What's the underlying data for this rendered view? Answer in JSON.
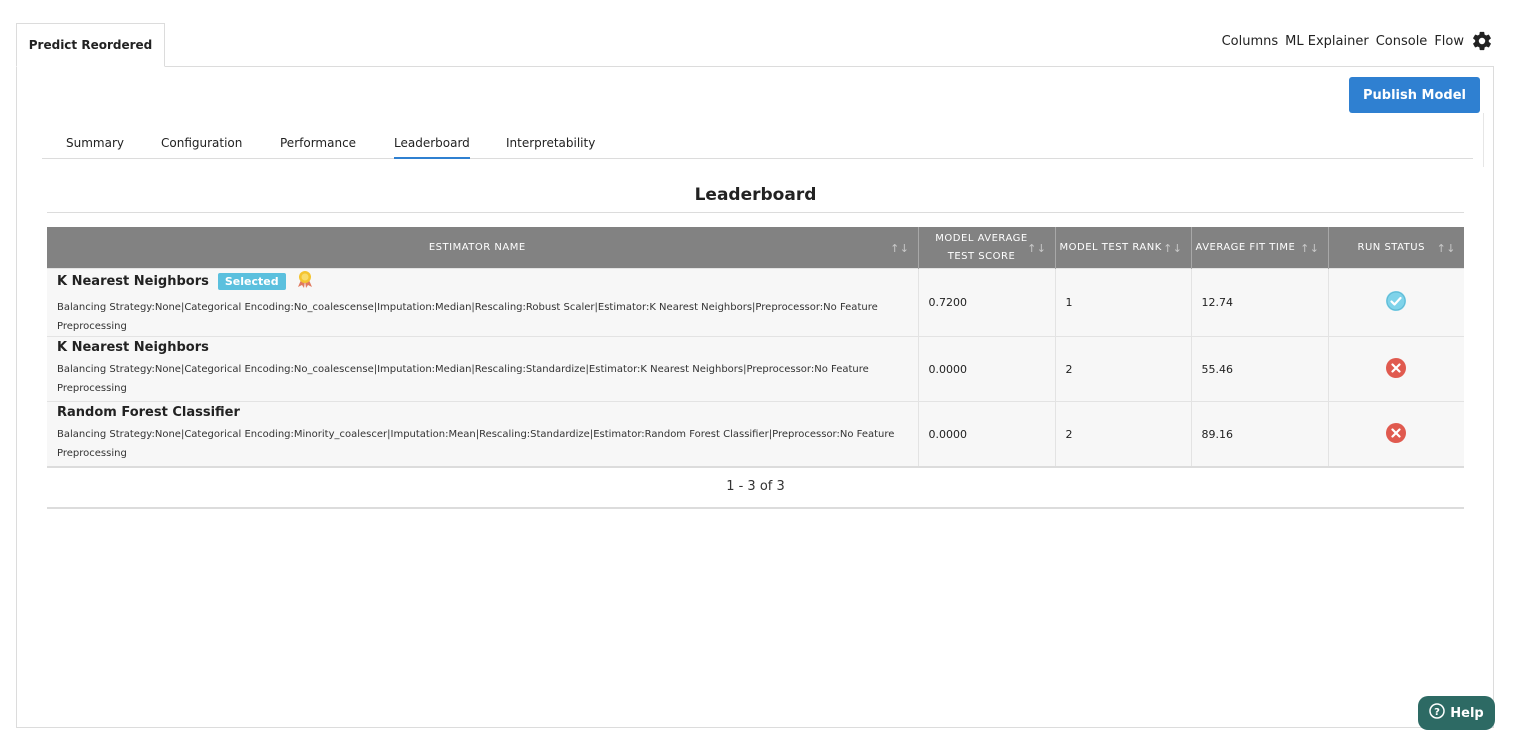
{
  "doc_tab": {
    "label": "Predict Reordered"
  },
  "top_links": {
    "columns": "Columns",
    "ml_explainer": "ML Explainer",
    "console": "Console",
    "flow": "Flow"
  },
  "publish_button": "Publish Model",
  "tabs": [
    "Summary",
    "Configuration",
    "Performance",
    "Leaderboard",
    "Interpretability"
  ],
  "active_tab": "Leaderboard",
  "leaderboard_title": "Leaderboard",
  "table": {
    "headers": {
      "estimator_name": "ESTIMATOR NAME",
      "model_average_test_score_1": "MODEL AVERAGE",
      "model_average_test_score_2": "TEST SCORE",
      "model_test_rank": "MODEL TEST RANK",
      "average_fit_time": "AVERAGE FIT TIME",
      "run_status": "RUN STATUS"
    },
    "rows": [
      {
        "name": "K Nearest Neighbors",
        "badge": "Selected",
        "description": "Balancing Strategy:None|Categorical Encoding:No_coalescense|Imputation:Median|Rescaling:Robust Scaler|Estimator:K Nearest Neighbors|Preprocessor:No Feature Preprocessing",
        "score": "0.7200",
        "rank": "1",
        "fit_time": "12.74",
        "status": "success"
      },
      {
        "name": "K Nearest Neighbors",
        "badge": "",
        "description": "Balancing Strategy:None|Categorical Encoding:No_coalescense|Imputation:Median|Rescaling:Standardize|Estimator:K Nearest Neighbors|Preprocessor:No Feature Preprocessing",
        "score": "0.0000",
        "rank": "2",
        "fit_time": "55.46",
        "status": "failed"
      },
      {
        "name": "Random Forest Classifier",
        "badge": "",
        "description": "Balancing Strategy:None|Categorical Encoding:Minority_coalescer|Imputation:Mean|Rescaling:Standardize|Estimator:Random Forest Classifier|Preprocessor:No Feature Preprocessing",
        "score": "0.0000",
        "rank": "2",
        "fit_time": "89.16",
        "status": "failed"
      }
    ]
  },
  "pagination": "1 - 3 of 3",
  "help_button": "Help",
  "colors": {
    "accent": "#2f80d1",
    "success": "#7fd3ea",
    "error": "#e05a4f",
    "header_bg": "#828282"
  }
}
